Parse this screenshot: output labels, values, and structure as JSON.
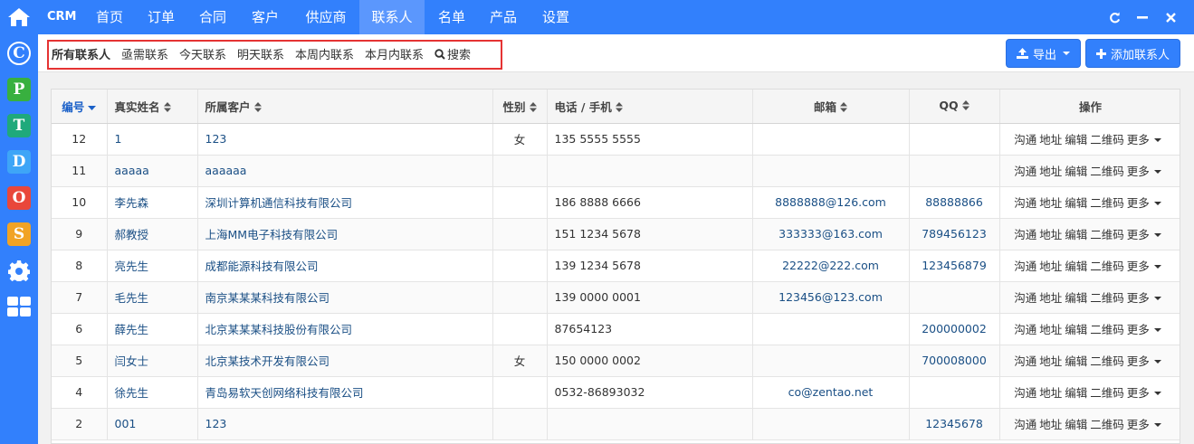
{
  "brand": "CRM",
  "nav": [
    "首页",
    "订单",
    "合同",
    "客户",
    "供应商",
    "联系人",
    "名单",
    "产品",
    "设置"
  ],
  "nav_active": "联系人",
  "filters": [
    "所有联系人",
    "亟需联系",
    "今天联系",
    "明天联系",
    "本周内联系",
    "本月内联系",
    "搜索"
  ],
  "actions": {
    "export": "导出",
    "add": "添加联系人"
  },
  "rail_apps": [
    "C",
    "P",
    "T",
    "D",
    "O",
    "S"
  ],
  "columns": [
    "编号",
    "真实姓名",
    "所属客户",
    "性别",
    "电话 / 手机",
    "邮箱",
    "QQ",
    "操作"
  ],
  "row_actions": [
    "沟通",
    "地址",
    "编辑",
    "二维码",
    "更多"
  ],
  "rows": [
    {
      "id": "12",
      "name": "1",
      "customer": "123",
      "gender": "女",
      "phone": "135 5555 5555",
      "email": "",
      "qq": ""
    },
    {
      "id": "11",
      "name": "aaaaa",
      "customer": "aaaaaa",
      "gender": "",
      "phone": "",
      "email": "",
      "qq": ""
    },
    {
      "id": "10",
      "name": "李先森",
      "customer": "深圳计算机通信科技有限公司",
      "gender": "",
      "phone": "186 8888 6666",
      "email": "8888888@126.com",
      "qq": "88888866"
    },
    {
      "id": "9",
      "name": "郝教授",
      "customer": "上海MM电子科技有限公司",
      "gender": "",
      "phone": "151 1234 5678",
      "email": "333333@163.com",
      "qq": "789456123"
    },
    {
      "id": "8",
      "name": "亮先生",
      "customer": "成都能源科技有限公司",
      "gender": "",
      "phone": "139 1234 5678",
      "email": "22222@222.com",
      "qq": "123456879"
    },
    {
      "id": "7",
      "name": "毛先生",
      "customer": "南京某某某科技有限公司",
      "gender": "",
      "phone": "139 0000 0001",
      "email": "123456@123.com",
      "qq": ""
    },
    {
      "id": "6",
      "name": "薛先生",
      "customer": "北京某某某科技股份有限公司",
      "gender": "",
      "phone": "87654123",
      "email": "",
      "qq": "200000002"
    },
    {
      "id": "5",
      "name": "闫女士",
      "customer": "北京某技术开发有限公司",
      "gender": "女",
      "phone": "150 0000 0002",
      "email": "",
      "qq": "700008000"
    },
    {
      "id": "4",
      "name": "徐先生",
      "customer": "青岛易软天创网络科技有限公司",
      "gender": "",
      "phone": "0532-86893032",
      "email": "co@zentao.net",
      "qq": ""
    },
    {
      "id": "2",
      "name": "001",
      "customer": "123",
      "gender": "",
      "phone": "",
      "email": "",
      "qq": "12345678"
    }
  ]
}
